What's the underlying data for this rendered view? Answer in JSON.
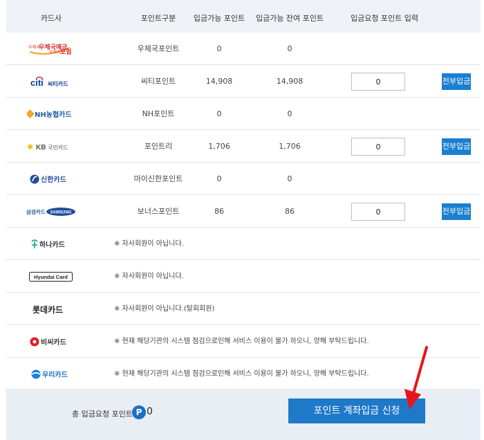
{
  "header": {
    "card_company": "카드사",
    "point_type": "포인트구분",
    "available": "입금가능 포인트",
    "remaining": "입금가능 잔여 포인트",
    "request": "입금요청 포인트 입력"
  },
  "rows": [
    {
      "logo_text": "우체국예금",
      "logo_sub": "우체국보험",
      "name": "우체국포인트",
      "available": "0",
      "remaining": "0"
    },
    {
      "logo_text": "citi",
      "logo_sub": "씨티카드",
      "name": "씨티포인트",
      "available": "14,908",
      "remaining": "14,908",
      "input": "0",
      "button": "전부입금"
    },
    {
      "logo_text": "NH농협카드",
      "name": "NH포인트",
      "available": "0",
      "remaining": "0"
    },
    {
      "logo_text": "KB",
      "logo_sub": "국민카드",
      "name": "포인트리",
      "available": "1,706",
      "remaining": "1,706",
      "input": "0",
      "button": "전부입금"
    },
    {
      "logo_text": "신한카드",
      "name": "마이신한포인트",
      "available": "0",
      "remaining": "0"
    },
    {
      "logo_text": "삼성카드",
      "logo_sub": "SAMSUNG",
      "name": "보너스포인트",
      "available": "86",
      "remaining": "86",
      "input": "0",
      "button": "전부입금"
    },
    {
      "logo_text": "하나카드",
      "note": "※ 자사회원이 아닙니다."
    },
    {
      "logo_text": "Hyundai Card",
      "note": "※ 자사회원이 아닙니다."
    },
    {
      "logo_text": "롯데카드",
      "note": "※ 자사회원이 아닙니다.(탈회회원)"
    },
    {
      "logo_text": "비씨카드",
      "note": "※ 현재 해당기관의 시스템 점검으로인해 서비스 이용이 불가 하오니, 양해 부탁드립니다."
    },
    {
      "logo_text": "우리카드",
      "note": "※ 현재 해당기관의 시스템 점검으로인해 서비스 이용이 불가 하오니, 양해 부탁드립니다."
    }
  ],
  "footer": {
    "total_label": "총 입금요청 포인트",
    "badge": "P",
    "total_value": "0",
    "submit": "포인트 계좌입금 신청"
  },
  "colors": {
    "accent": "#1a7fd0",
    "header_bg": "#eef1f6",
    "footer_bg": "#e9eef5",
    "arrow": "#e8141b"
  }
}
